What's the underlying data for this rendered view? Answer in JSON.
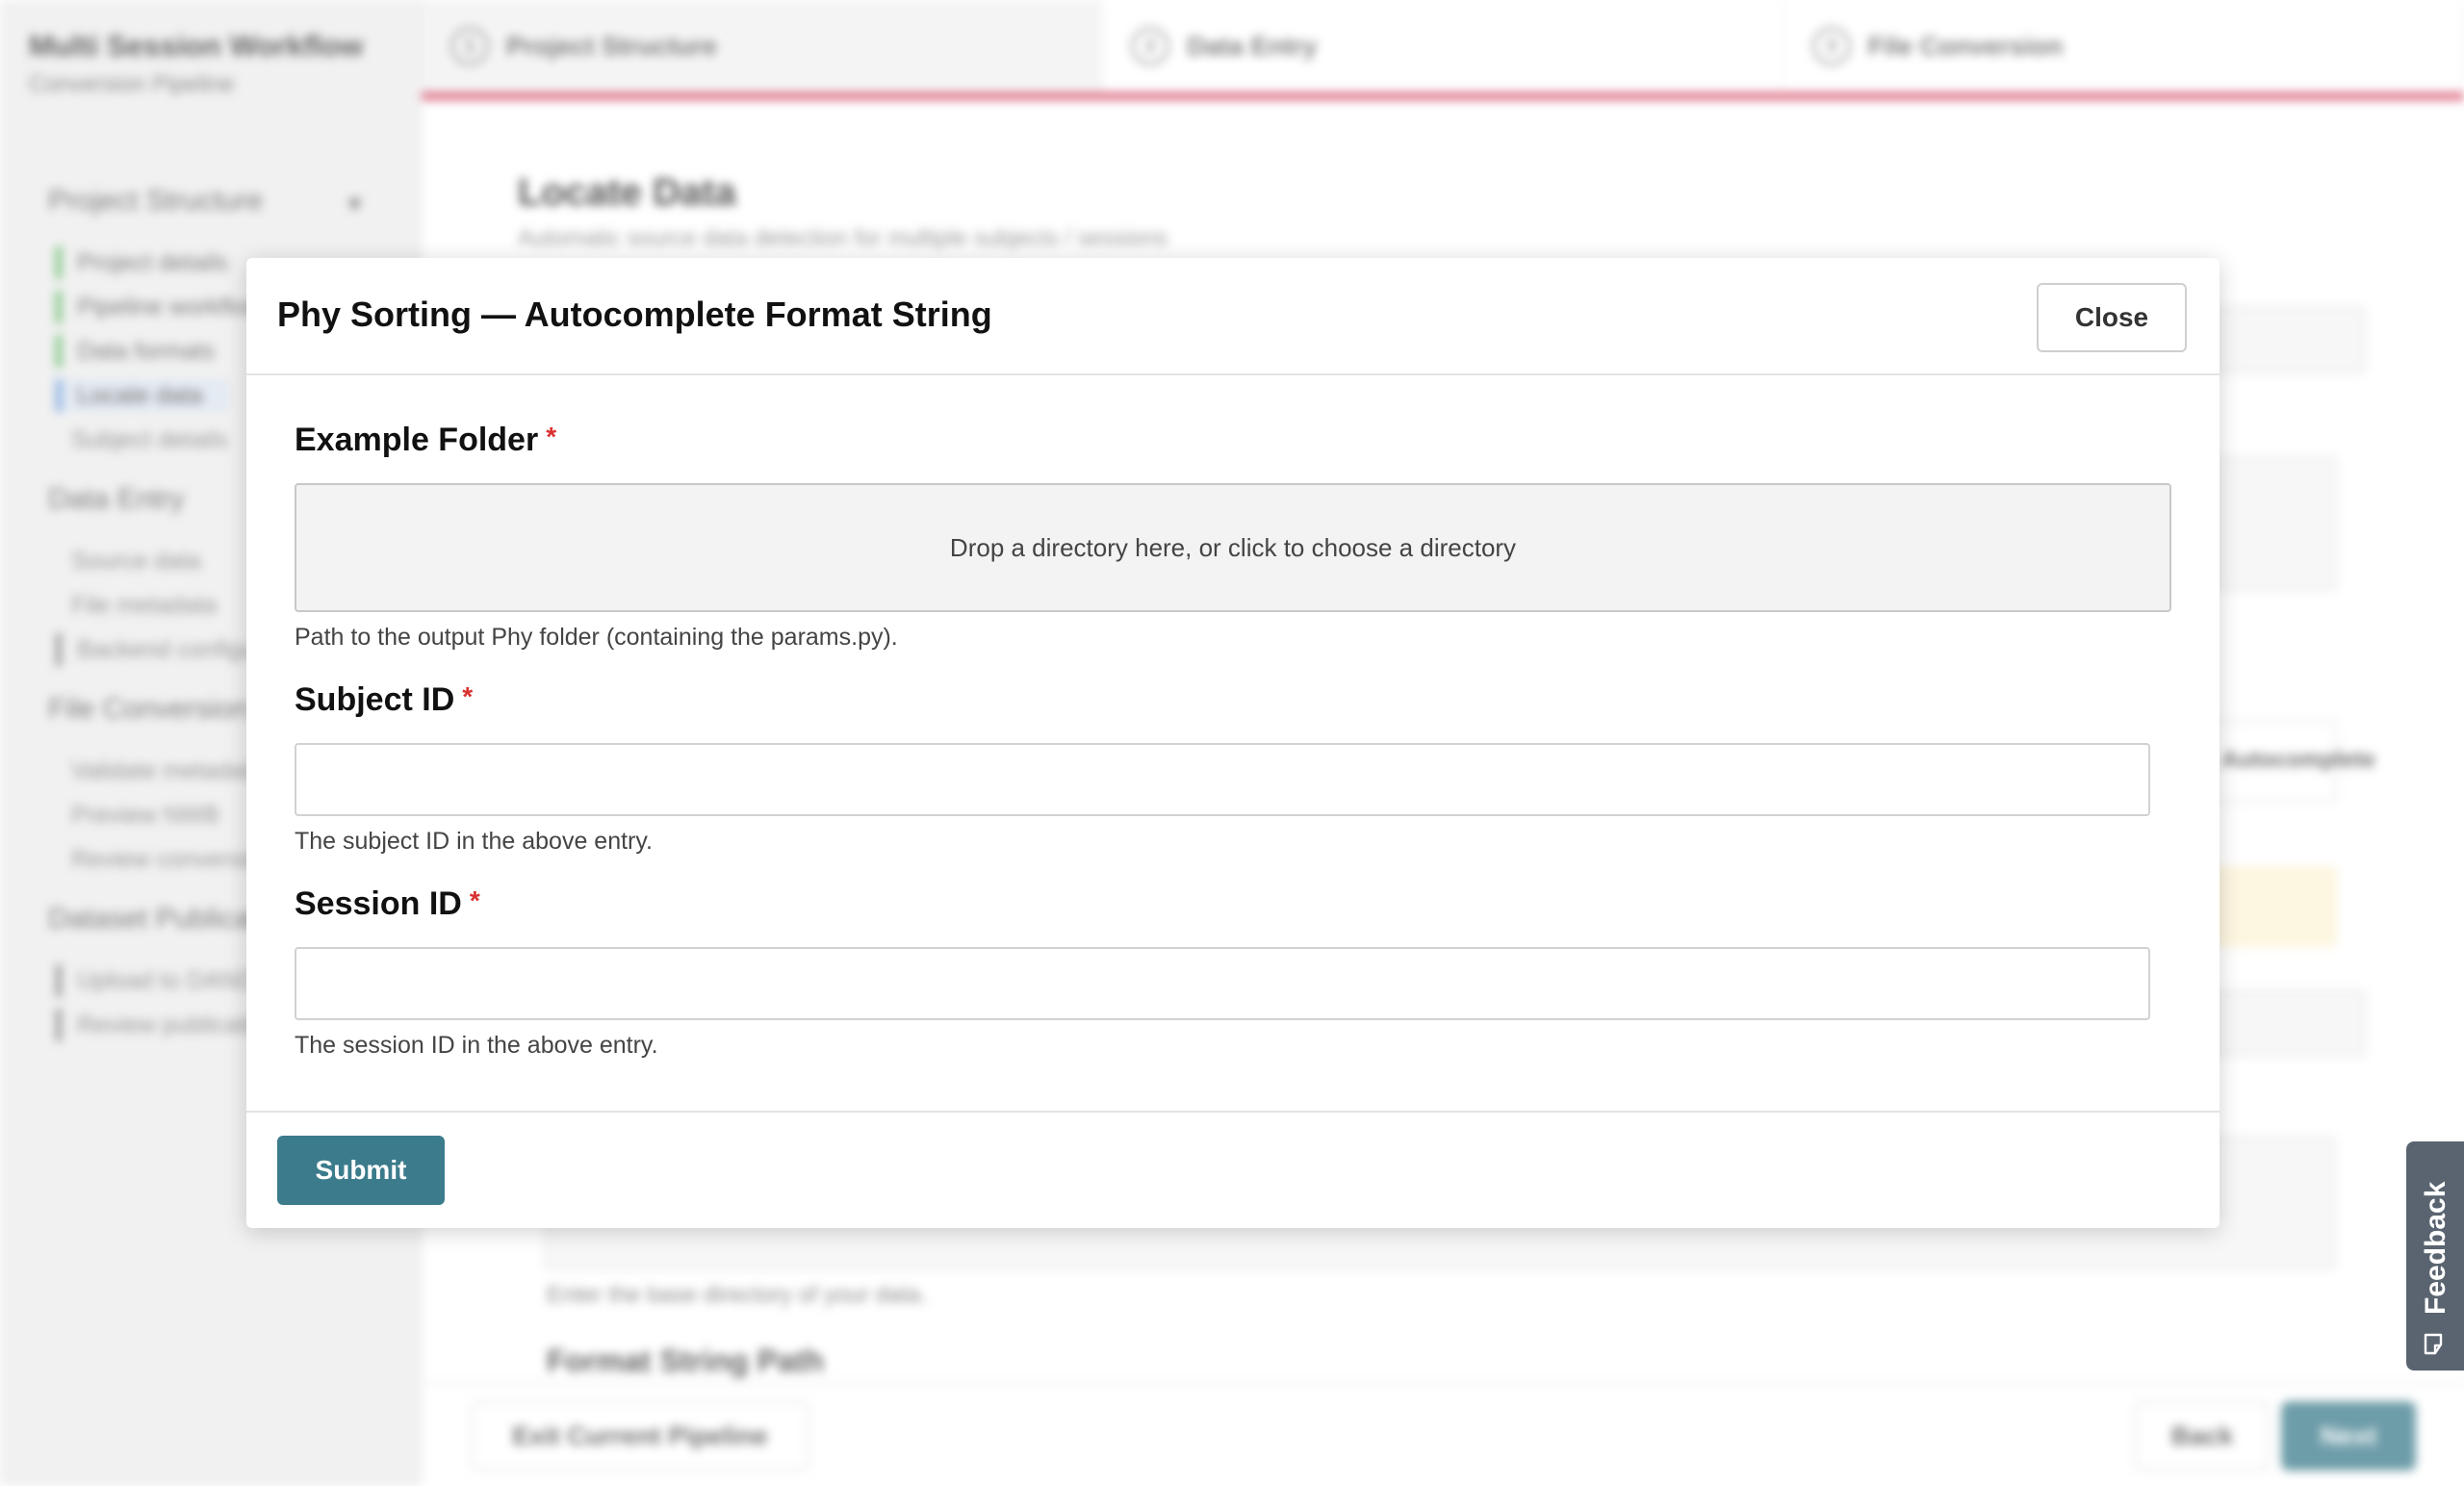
{
  "sidebar": {
    "title": "Multi Session Workflow",
    "subtitle": "Conversion Pipeline",
    "sections": [
      {
        "label": "Project Structure",
        "items": [
          "Project details",
          "Pipeline workflow",
          "Data formats",
          "Locate data",
          "Subject details"
        ]
      },
      {
        "label": "Data Entry",
        "items": [
          "Source data",
          "File metadata",
          "Backend configuration"
        ]
      },
      {
        "label": "File Conversion",
        "items": [
          "Validate metadata",
          "Preview NWB",
          "Review conversion"
        ]
      },
      {
        "label": "Dataset Publication",
        "items": [
          "Upload to DANDI",
          "Review publication"
        ]
      }
    ]
  },
  "steps": [
    {
      "number": "1",
      "label": "Project Structure"
    },
    {
      "number": "2",
      "label": "Data Entry"
    },
    {
      "number": "3",
      "label": "File Conversion"
    }
  ],
  "page": {
    "title": "Locate Data",
    "subtitle": "Automatic source data detection for multiple subjects / sessions",
    "autocomplete_label": "Autocomplete",
    "base_dir_help": "Enter the base directory of your data.",
    "format_string_label": "Format String Path"
  },
  "footer": {
    "exit_label": "Exit Current Pipeline",
    "back_label": "Back",
    "next_label": "Next"
  },
  "modal": {
    "title": "Phy Sorting — Autocomplete Format String",
    "close_label": "Close",
    "example_folder": {
      "label": "Example Folder",
      "required_mark": "*",
      "dropzone_text": "Drop a directory here, or click to choose a directory",
      "help": "Path to the output Phy folder (containing the params.py)."
    },
    "subject_id": {
      "label": "Subject ID",
      "required_mark": "*",
      "value": "",
      "help": "The subject ID in the above entry."
    },
    "session_id": {
      "label": "Session ID",
      "required_mark": "*",
      "value": "",
      "help": "The session ID in the above entry."
    },
    "submit_label": "Submit"
  },
  "feedback": {
    "label": "Feedback"
  },
  "colors": {
    "accent": "#3b7b8c",
    "progress_bar": "#d23a5a",
    "required": "#d93030"
  }
}
